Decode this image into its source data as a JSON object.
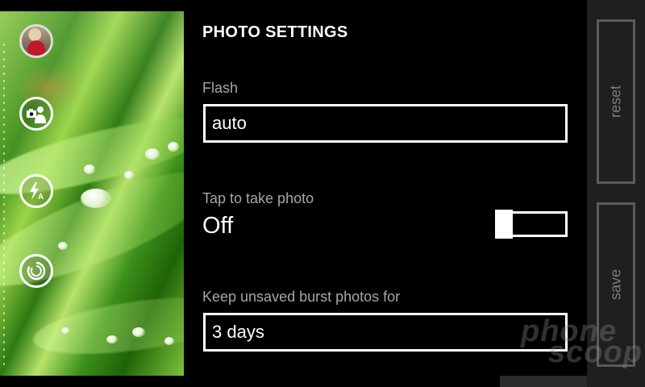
{
  "settings": {
    "title": "PHOTO SETTINGS",
    "flash": {
      "label": "Flash",
      "value": "auto"
    },
    "tap_to_take": {
      "label": "Tap to take photo",
      "state": "Off",
      "enabled": false
    },
    "burst": {
      "label": "Keep unsaved burst photos for",
      "value": "3 days"
    }
  },
  "appbar": {
    "reset_label": "reset",
    "save_label": "save"
  },
  "camera_controls": [
    {
      "name": "last-photo-thumbnail-button"
    },
    {
      "name": "lenses-button",
      "icon": "person-camera-icon"
    },
    {
      "name": "flash-auto-button",
      "icon": "flash-auto-icon"
    },
    {
      "name": "burst-mode-button",
      "icon": "burst-icon"
    }
  ],
  "watermark": {
    "line1": "phone",
    "line2": "scoop"
  },
  "colors": {
    "background": "#000000",
    "label_gray": "#a6a6a6",
    "appbar_bg": "#1f1f1f",
    "appbar_text": "#7a7a7a"
  }
}
